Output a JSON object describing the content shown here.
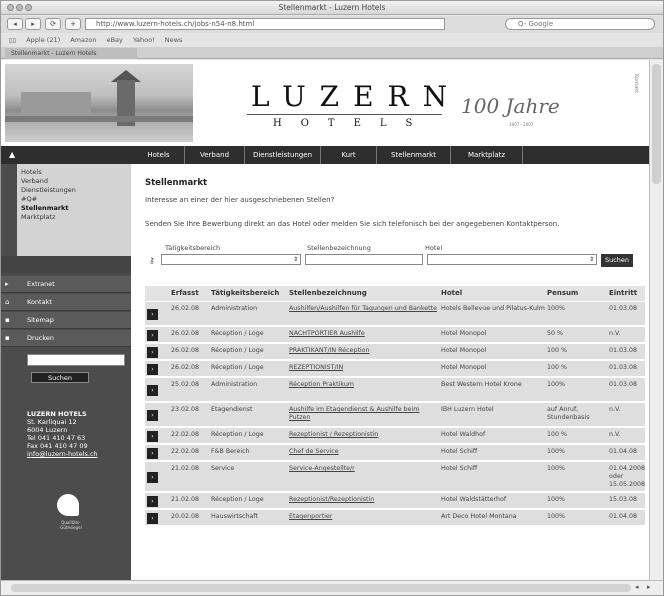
{
  "window": {
    "title": "Stellenmarkt - Luzern Hotels"
  },
  "toolbar": {
    "url": "http://www.luzern-hotels.ch/jobs-n54-n8.html",
    "search_placeholder": "Q- Google"
  },
  "bookmarks": [
    "Apple (21)",
    "Amazon",
    "eBay",
    "Yahoo!",
    "News"
  ],
  "tab": {
    "label": "Stellenmarkt - Luzern Hotels"
  },
  "header": {
    "logo_main": "LUZERN",
    "logo_sub": "HOTELS",
    "anniversary": "100 Jahre",
    "anniversary_years": "1907 - 2007",
    "side_label": "Kontakt"
  },
  "nav": {
    "items": [
      "Hotels",
      "Verband",
      "Dienstleistungen",
      "Kurt",
      "Stellenmarkt",
      "Marktplatz"
    ]
  },
  "sidebar": {
    "sub_items": [
      "Hotels",
      "Verband",
      "Dienstleistungen",
      "#Q#",
      "Stellenmarkt",
      "Marktplatz"
    ],
    "tools": [
      {
        "icon": "▸",
        "label": "Extranet"
      },
      {
        "icon": "⌂",
        "label": "Kontakt"
      },
      {
        "icon": "▪",
        "label": "Sitemap"
      },
      {
        "icon": "▪",
        "label": "Drucken"
      }
    ],
    "search_button": "Suchen",
    "address": {
      "name": "LUZERN HOTELS",
      "street": "St. Karliquai 12",
      "city": "6004 Luzern",
      "tel": "Tel 041 410 47 63",
      "fax": "Fax 041 410 47 09",
      "email": "info@luzern-hotels.ch"
    },
    "q_label": "Qualitäts-Gütesiegel"
  },
  "content": {
    "title": "Stellenmarkt",
    "intro": "Interesse an einer der hier ausgeschriebenen Stellen?",
    "intro2": "Senden Sie Ihre Bewerbung direkt an das Hotel oder melden Sie sich telefonisch bei der angegebenen Kontaktperson.",
    "filters": {
      "labels": [
        "Tätigkeitsbereich",
        "Stellenbezeichnung",
        "Hotel"
      ],
      "button": "Suchen"
    },
    "table": {
      "headers": [
        "Erfasst",
        "Tätigkeitsbereich",
        "Stellenbezeichnung",
        "Hotel",
        "Pensum",
        "Eintritt"
      ],
      "rows": [
        [
          "26.02.08",
          "Administration",
          "Aushilfen/Aushilfen für Tagungen und Bankette",
          "Hotels Bellevue und Pilatus-Kulm",
          "100%",
          "01.03.08"
        ],
        [
          "26.02.08",
          "Réception / Loge",
          "NACHTPORTIER Aushilfe",
          "Hotel Monopol",
          "50 %",
          "n.V."
        ],
        [
          "26.02.08",
          "Réception / Loge",
          "PRAKTIKANT/IN Réception",
          "Hotel Monopol",
          "100 %",
          "01.03.08"
        ],
        [
          "26.02.08",
          "Réception / Loge",
          "REZEPTIONIST/IN",
          "Hotel Monopol",
          "100 %",
          "01.03.08"
        ],
        [
          "25.02.08",
          "Administration",
          "Réception Praktikum",
          "Best Western Hotel Krone",
          "100%",
          "01.03.08"
        ],
        [
          "23.02.08",
          "Etagendienst",
          "Aushilfe im Etagendienst & Aushilfe beim Putzen",
          "IBH Luzern Hotel",
          "auf Anruf, Stundenbasis",
          "n.V."
        ],
        [
          "22.02.08",
          "Réception / Loge",
          "Rezeptionist / Rezeptionistin",
          "Hotel Waldhof",
          "100 %",
          "n.V."
        ],
        [
          "22.02.08",
          "F&B Bereich",
          "Chef de Service",
          "Hotel Schiff",
          "100%",
          "01.04.08"
        ],
        [
          "21.02.08",
          "Service",
          "Service-Angestellte/r",
          "Hotel Schiff",
          "100%",
          "01.04.2008 oder 15.05.2008"
        ],
        [
          "21.02.08",
          "Réception / Loge",
          "Rezeptionist/Rezeptionistin",
          "Hotel Waldstätterhof",
          "100%",
          "15.03.08"
        ],
        [
          "20.02.08",
          "Hauswirtschaft",
          "Etagenportier",
          "Art Deco Hotel Montana",
          "100%",
          "01.04.08"
        ]
      ]
    }
  }
}
